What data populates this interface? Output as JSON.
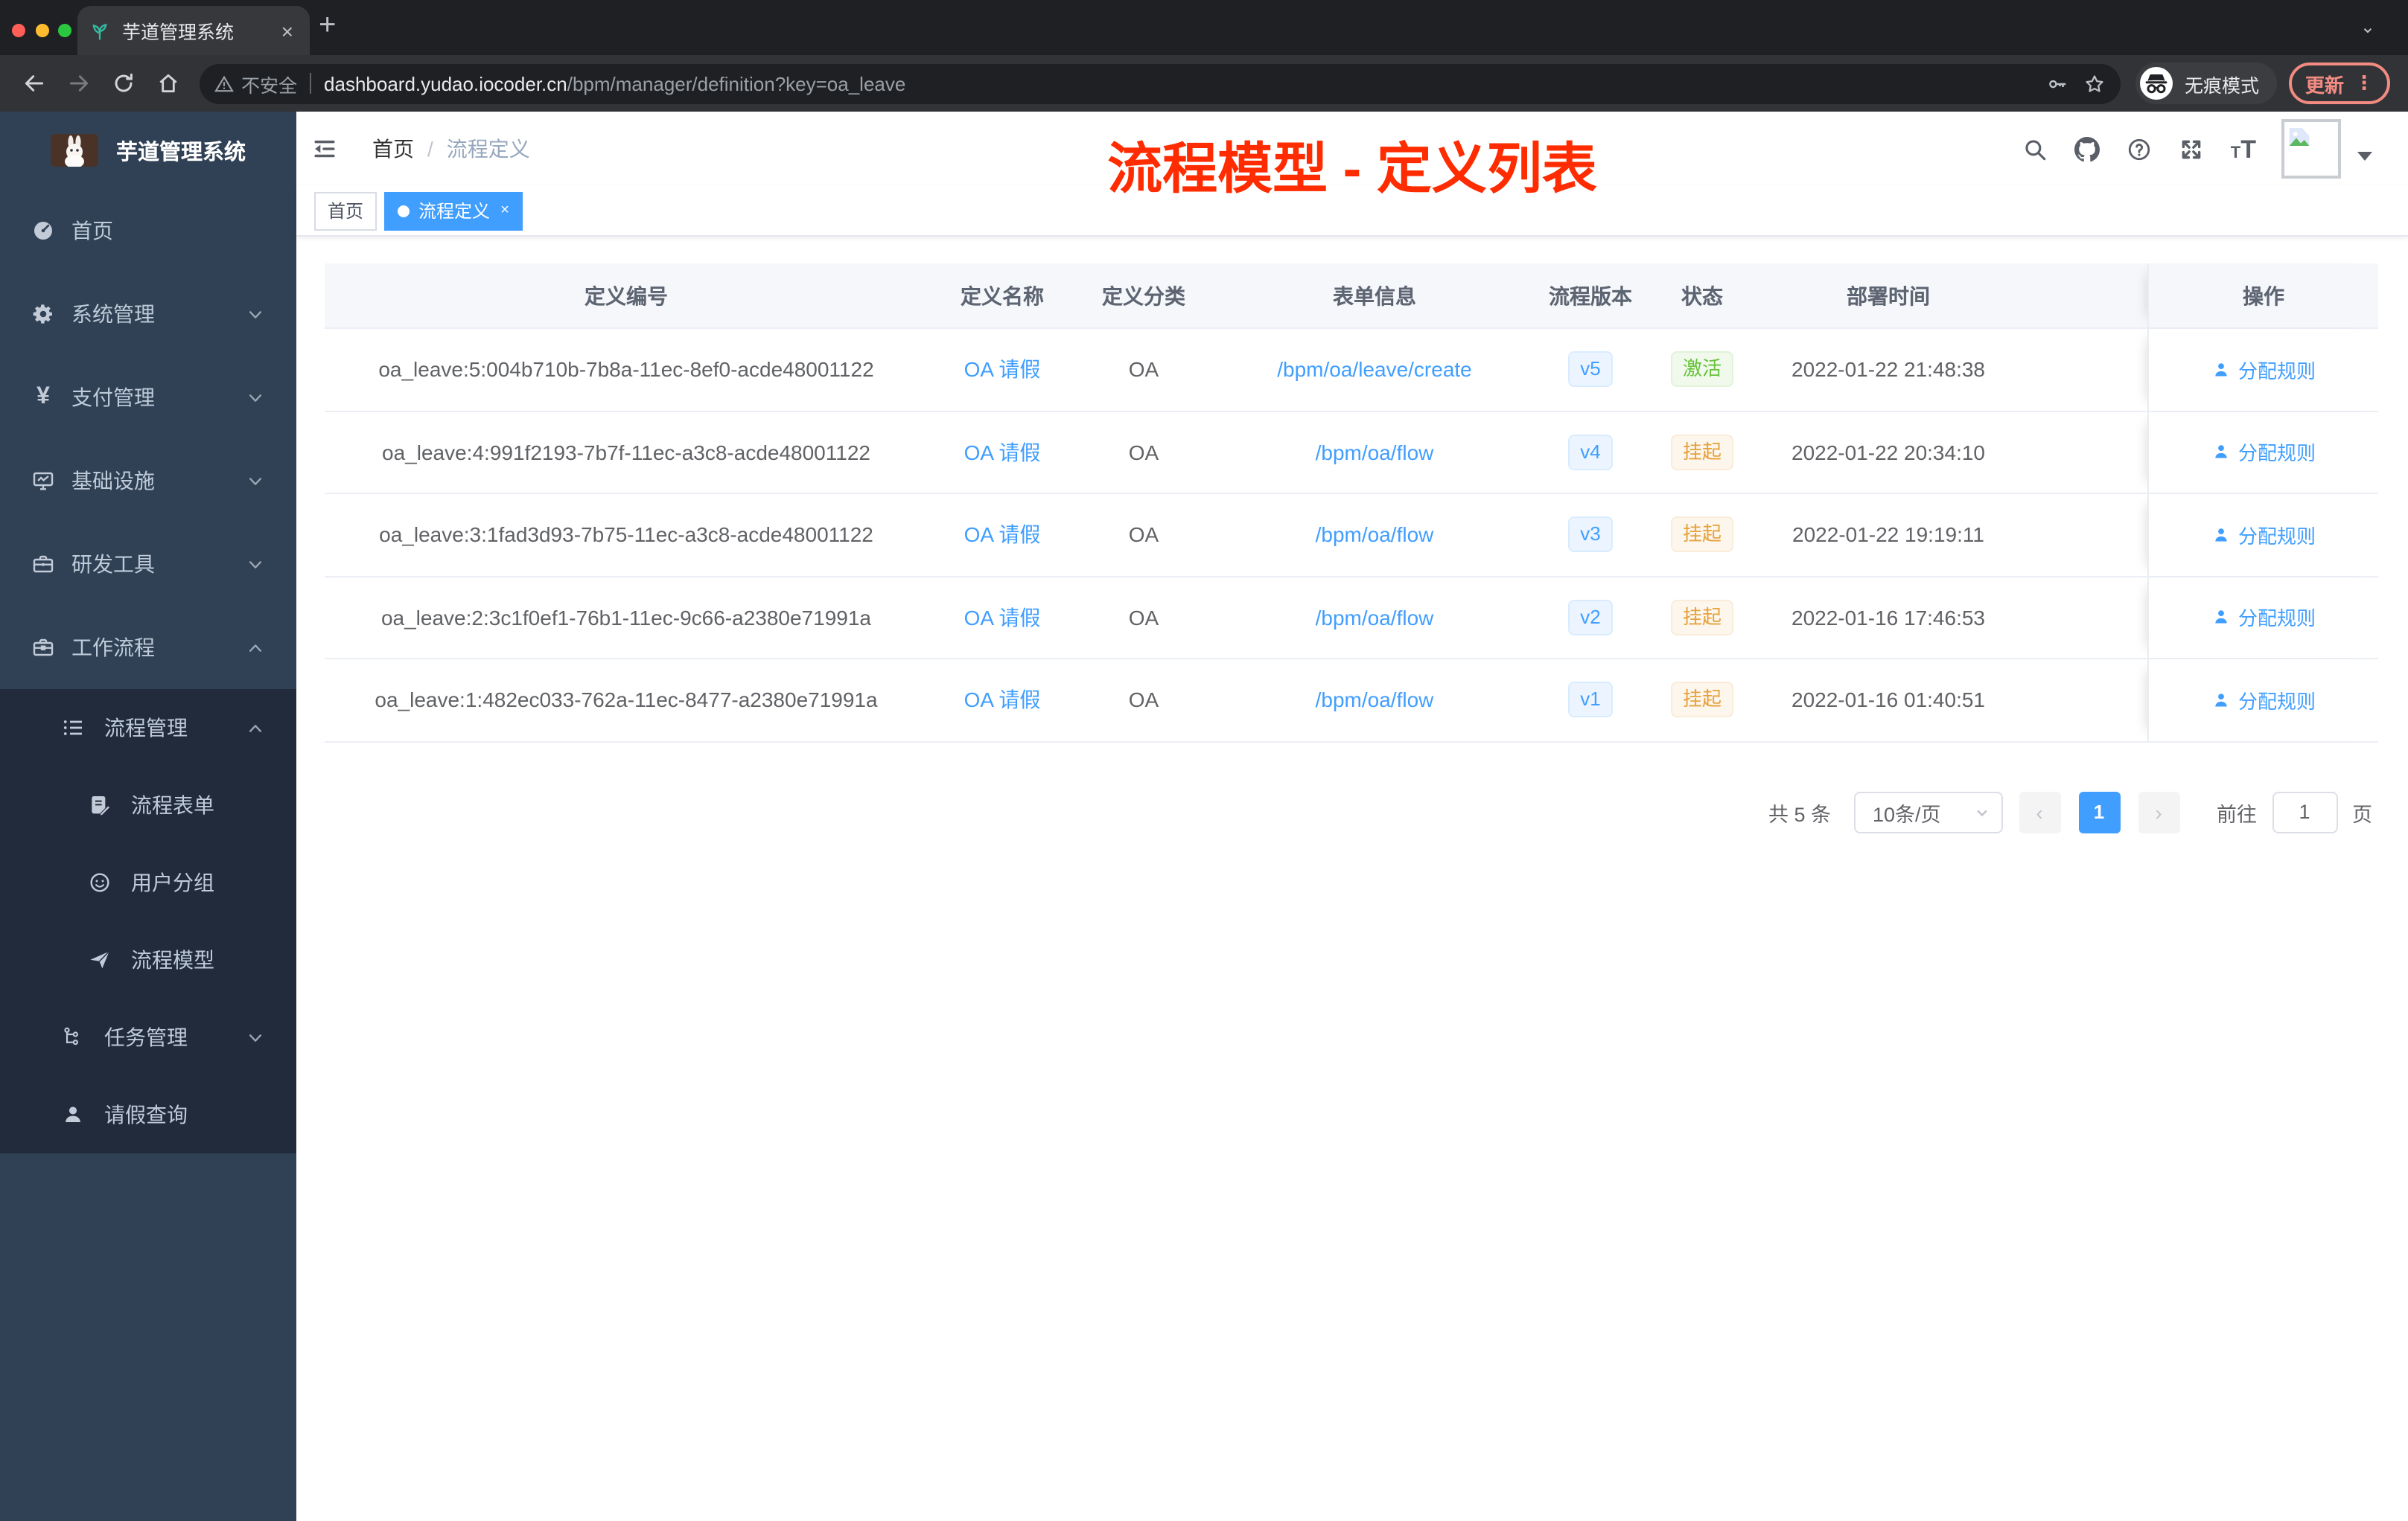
{
  "colors": {
    "accent": "#409eff",
    "annotation": "#fe2c00",
    "success": "#67c23a",
    "warning": "#e6a23c",
    "sidebar": "#304156",
    "sidebar_dark": "#212b3c"
  },
  "browser": {
    "tab_title": "芋道管理系统",
    "close_glyph": "×",
    "new_tab_glyph": "+",
    "tab_search_glyph": "⌄",
    "security_label": "不安全",
    "url_host": "dashboard.yudao.iocoder.cn",
    "url_path": "/bpm/manager/definition?key=oa_leave",
    "incognito_label": "无痕模式",
    "update_label": "更新",
    "menu_dots": "⋮"
  },
  "sidebar": {
    "logo_title": "芋道管理系统",
    "items": [
      {
        "icon": "dashboard-icon",
        "label": "首页",
        "level": 1,
        "chevron": null,
        "dark": false
      },
      {
        "icon": "gear-icon",
        "label": "系统管理",
        "level": 1,
        "chevron": "down",
        "dark": false
      },
      {
        "icon": "yen-icon",
        "label": "支付管理",
        "level": 1,
        "chevron": "down",
        "dark": false
      },
      {
        "icon": "monitor-icon",
        "label": "基础设施",
        "level": 1,
        "chevron": "down",
        "dark": false
      },
      {
        "icon": "toolbox-icon",
        "label": "研发工具",
        "level": 1,
        "chevron": "down",
        "dark": false
      },
      {
        "icon": "briefcase-icon",
        "label": "工作流程",
        "level": 1,
        "chevron": "up",
        "dark": false
      },
      {
        "icon": "list-icon",
        "label": "流程管理",
        "level": 2,
        "chevron": "up",
        "dark": true
      },
      {
        "icon": "form-icon",
        "label": "流程表单",
        "level": 3,
        "chevron": null,
        "dark": true
      },
      {
        "icon": "users-icon",
        "label": "用户分组",
        "level": 3,
        "chevron": null,
        "dark": true
      },
      {
        "icon": "plane-icon",
        "label": "流程模型",
        "level": 3,
        "chevron": null,
        "dark": true
      },
      {
        "icon": "tree-icon",
        "label": "任务管理",
        "level": 2,
        "chevron": "down",
        "dark": true
      },
      {
        "icon": "user-icon",
        "label": "请假查询",
        "level": 2,
        "chevron": null,
        "dark": true
      }
    ]
  },
  "header": {
    "breadcrumb_home": "首页",
    "breadcrumb_sep": "/",
    "breadcrumb_current": "流程定义",
    "annotation": "流程模型 - 定义列表"
  },
  "tags": [
    {
      "label": "首页",
      "active": false,
      "closable": false
    },
    {
      "label": "流程定义",
      "active": true,
      "closable": true
    }
  ],
  "table": {
    "columns": [
      {
        "key": "id",
        "label": "定义编号"
      },
      {
        "key": "name",
        "label": "定义名称"
      },
      {
        "key": "category",
        "label": "定义分类"
      },
      {
        "key": "form",
        "label": "表单信息"
      },
      {
        "key": "version",
        "label": "流程版本"
      },
      {
        "key": "status",
        "label": "状态"
      },
      {
        "key": "time",
        "label": "部署时间"
      },
      {
        "key": "op",
        "label": "操作"
      }
    ],
    "rows": [
      {
        "id": "oa_leave:5:004b710b-7b8a-11ec-8ef0-acde48001122",
        "name": "OA 请假",
        "category": "OA",
        "form": "/bpm/oa/leave/create",
        "version": "v5",
        "status": {
          "label": "激活",
          "type": "success"
        },
        "time": "2022-01-22 21:48:38",
        "action": "分配规则"
      },
      {
        "id": "oa_leave:4:991f2193-7b7f-11ec-a3c8-acde48001122",
        "name": "OA 请假",
        "category": "OA",
        "form": "/bpm/oa/flow",
        "version": "v4",
        "status": {
          "label": "挂起",
          "type": "warning"
        },
        "time": "2022-01-22 20:34:10",
        "action": "分配规则"
      },
      {
        "id": "oa_leave:3:1fad3d93-7b75-11ec-a3c8-acde48001122",
        "name": "OA 请假",
        "category": "OA",
        "form": "/bpm/oa/flow",
        "version": "v3",
        "status": {
          "label": "挂起",
          "type": "warning"
        },
        "time": "2022-01-22 19:19:11",
        "action": "分配规则"
      },
      {
        "id": "oa_leave:2:3c1f0ef1-76b1-11ec-9c66-a2380e71991a",
        "name": "OA 请假",
        "category": "OA",
        "form": "/bpm/oa/flow",
        "version": "v2",
        "status": {
          "label": "挂起",
          "type": "warning"
        },
        "time": "2022-01-16 17:46:53",
        "action": "分配规则"
      },
      {
        "id": "oa_leave:1:482ec033-762a-11ec-8477-a2380e71991a",
        "name": "OA 请假",
        "category": "OA",
        "form": "/bpm/oa/flow",
        "version": "v1",
        "status": {
          "label": "挂起",
          "type": "warning"
        },
        "time": "2022-01-16 01:40:51",
        "action": "分配规则"
      }
    ]
  },
  "pagination": {
    "total": "共 5 条",
    "page_size": "10条/页",
    "prev_glyph": "‹",
    "page": "1",
    "next_glyph": "›",
    "goto_label": "前往",
    "goto_value": "1",
    "unit": "页"
  }
}
